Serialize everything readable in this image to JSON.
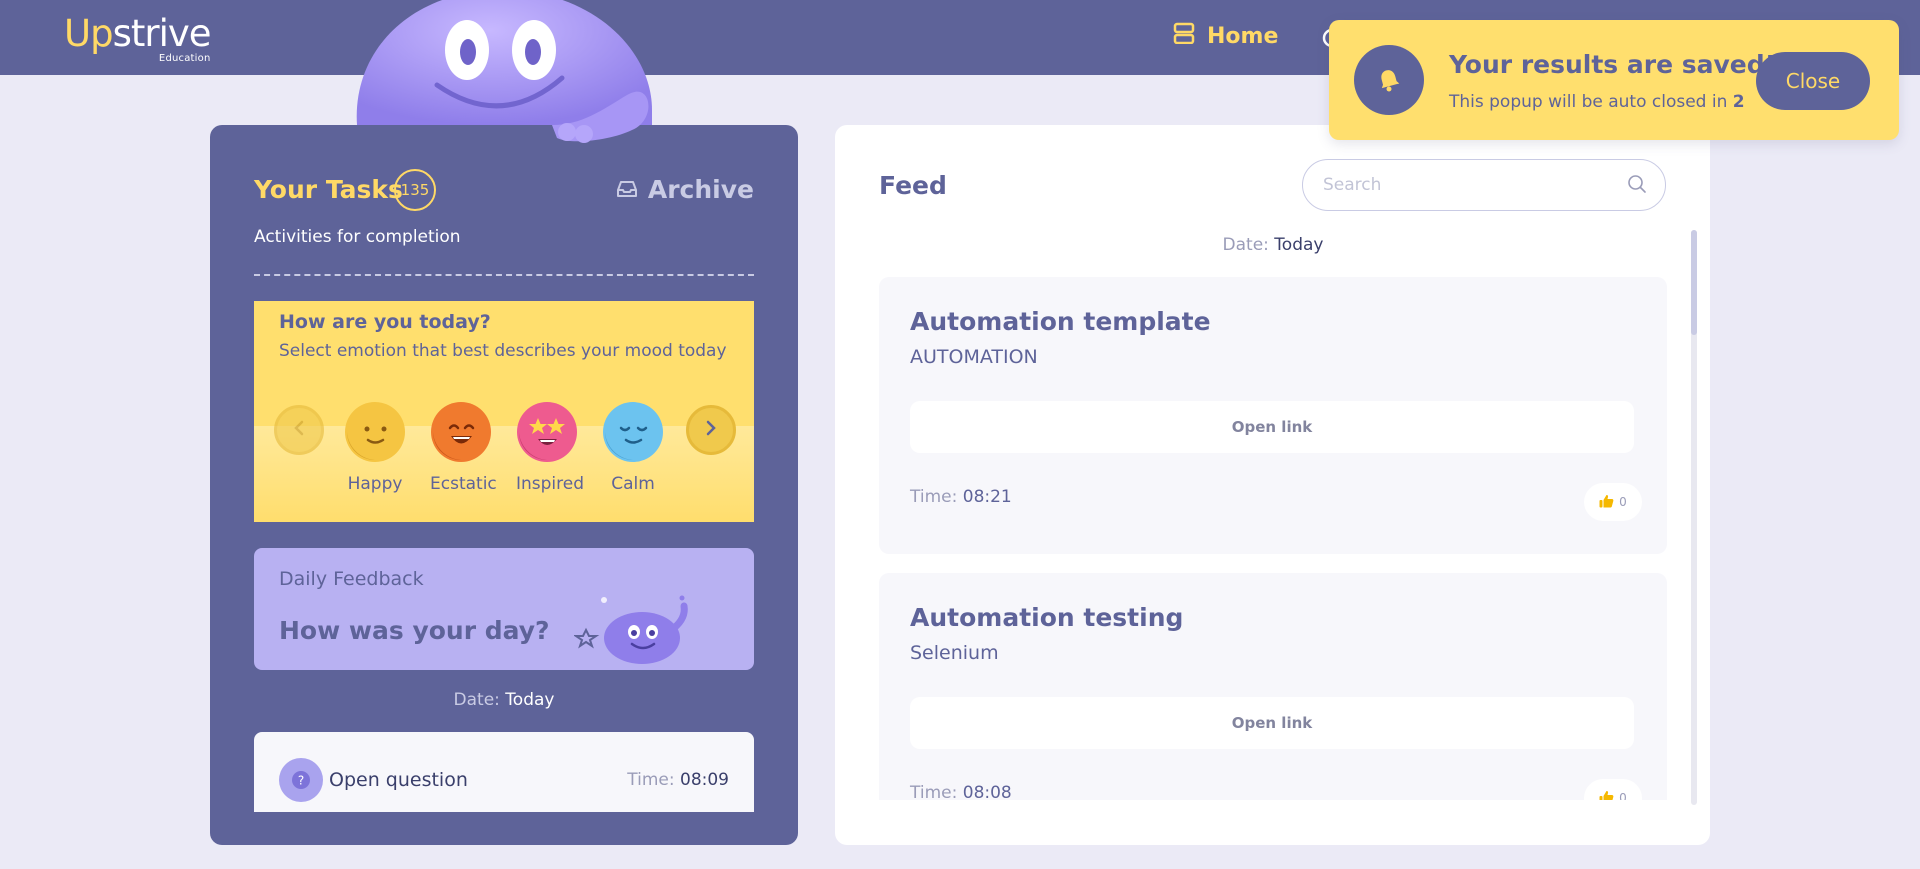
{
  "app": {
    "logo_main": "Up",
    "logo_rest": "strive",
    "logo_sub": "Education"
  },
  "nav": {
    "home_label": "Home"
  },
  "tasks": {
    "title": "Your Tasks",
    "count": "135",
    "archive_label": "Archive",
    "subtitle": "Activities for completion",
    "mood": {
      "title": "How are you today?",
      "subtitle": "Select emotion that best describes your mood today",
      "emotions": [
        {
          "label": "Happy",
          "color": "#f5c542"
        },
        {
          "label": "Ecstatic",
          "color": "#f07a2e"
        },
        {
          "label": "Inspired",
          "color": "#ee5b8f"
        },
        {
          "label": "Calm",
          "color": "#6cc3ef"
        }
      ]
    },
    "feedback": {
      "title": "Daily Feedback",
      "question": "How was your day?"
    },
    "date_label": "Date:",
    "date_value": "Today",
    "items": [
      {
        "type": "Open question",
        "time_label": "Time:",
        "time": "08:09"
      }
    ]
  },
  "feed": {
    "title": "Feed",
    "search_placeholder": "Search",
    "date_label": "Date:",
    "date_value": "Today",
    "cards": [
      {
        "title": "Automation template",
        "category": "AUTOMATION",
        "link_label": "Open link",
        "time_label": "Time:",
        "time": "08:21",
        "likes": "0"
      },
      {
        "title": "Automation testing",
        "category": "Selenium",
        "link_label": "Open link",
        "time_label": "Time:",
        "time": "08:08",
        "likes": "0"
      }
    ]
  },
  "toast": {
    "title": "Your results are saved!",
    "message": "This popup will be auto closed in",
    "countdown": "2",
    "close_label": "Close"
  },
  "colors": {
    "primary": "#5e6399",
    "accent": "#ffd966",
    "background": "#ebeaf6"
  }
}
